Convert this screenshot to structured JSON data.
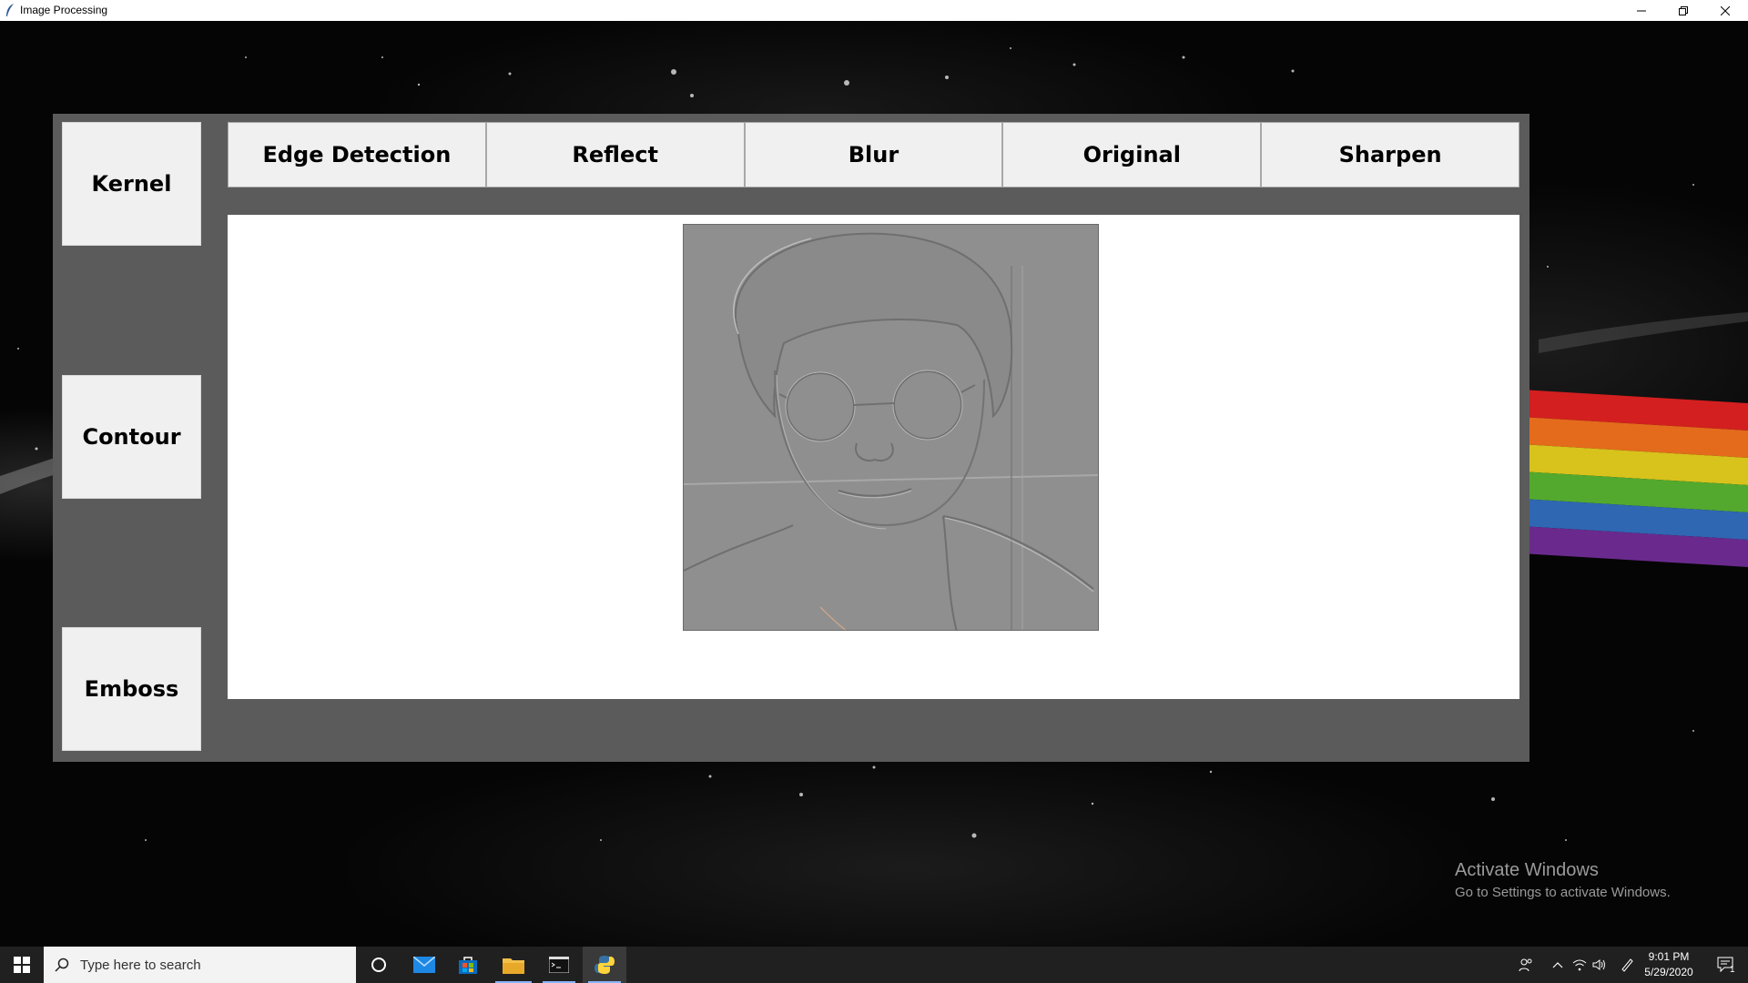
{
  "window": {
    "title": "Image Processing",
    "controls": [
      "minimize",
      "restore",
      "close"
    ]
  },
  "sidebar": {
    "buttons": [
      {
        "label": "Kernel"
      },
      {
        "label": "Contour"
      },
      {
        "label": "Emboss"
      }
    ]
  },
  "toolbar": {
    "tabs": [
      {
        "label": "Edge Detection"
      },
      {
        "label": "Reflect"
      },
      {
        "label": "Blur"
      },
      {
        "label": "Original"
      },
      {
        "label": "Sharpen"
      }
    ]
  },
  "preview": {
    "icon": "embossed-portrait-image"
  },
  "watermark": {
    "line1": "Activate Windows",
    "line2": "Go to Settings to activate Windows."
  },
  "taskbar": {
    "search_placeholder": "Type here to search",
    "apps": [
      "windows-start-icon",
      "cortana-icon",
      "mail-icon",
      "store-icon",
      "file-explorer-icon",
      "terminal-icon",
      "python-icon"
    ],
    "time": "9:01 PM",
    "date": "5/29/2020",
    "notification_count": "1"
  },
  "colors": {
    "panel": "#5b5b5b",
    "button": "#f0f0f0",
    "canvas": "#ffffff",
    "taskbar": "#202020"
  }
}
